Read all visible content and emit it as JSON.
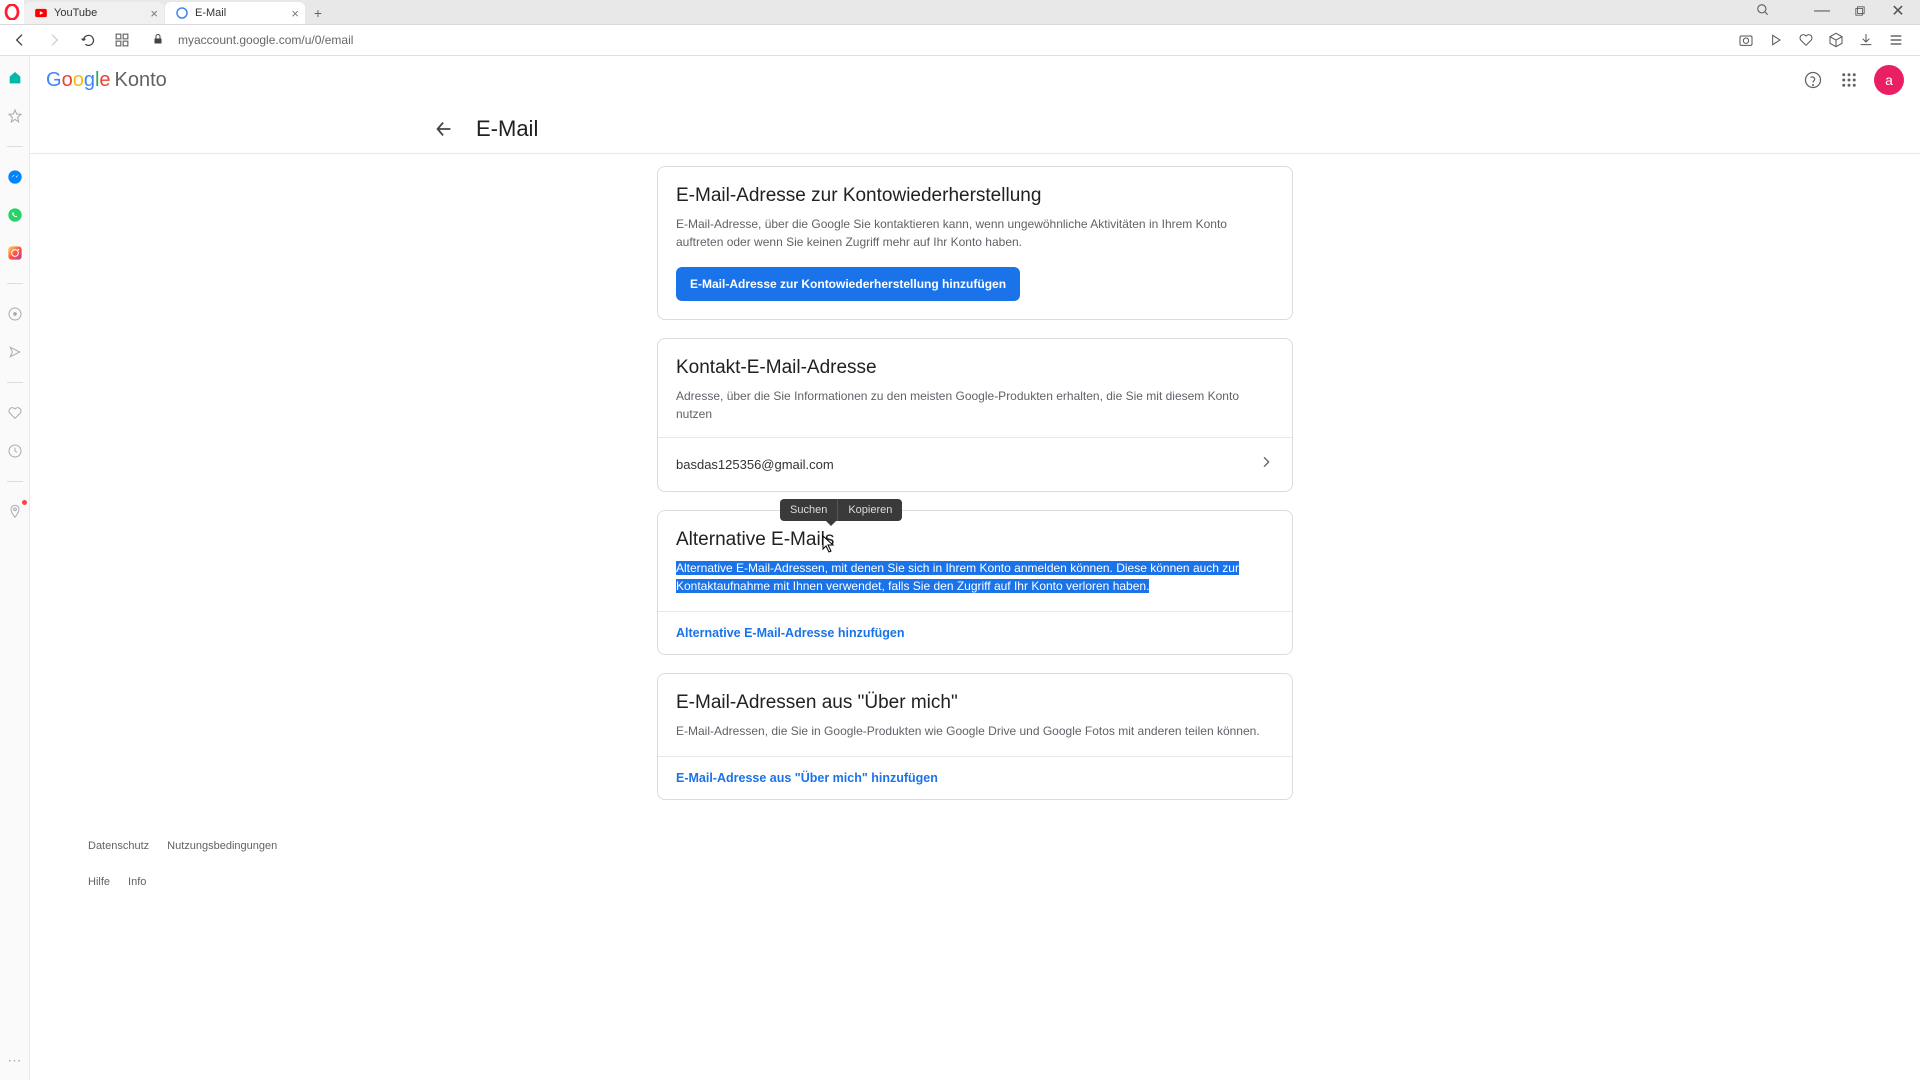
{
  "browser": {
    "tabs": [
      {
        "title": "YouTube",
        "active": false
      },
      {
        "title": "E-Mail",
        "active": true
      }
    ],
    "url": "myaccount.google.com/u/0/email"
  },
  "header": {
    "logo_suffix": "Konto",
    "avatar_letter": "a"
  },
  "page": {
    "title": "E-Mail"
  },
  "cards": {
    "recovery": {
      "title": "E-Mail-Adresse zur Kontowiederherstellung",
      "desc": "E-Mail-Adresse, über die Google Sie kontaktieren kann, wenn ungewöhnliche Aktivitäten in Ihrem Konto auftreten oder wenn Sie keinen Zugriff mehr auf Ihr Konto haben.",
      "button": "E-Mail-Adresse zur Kontowiederherstellung hinzufügen"
    },
    "contact": {
      "title": "Kontakt-E-Mail-Adresse",
      "desc": "Adresse, über die Sie Informationen zu den meisten Google-Produkten erhalten, die Sie mit diesem Konto nutzen",
      "email": "basdas125356@gmail.com"
    },
    "alternative": {
      "title": "Alternative E-Mails",
      "desc": "Alternative E-Mail-Adressen, mit denen Sie sich in Ihrem Konto anmelden können. Diese können auch zur Kontaktaufnahme mit Ihnen verwendet, falls Sie den Zugriff auf Ihr Konto verloren haben.",
      "link": "Alternative E-Mail-Adresse hinzufügen"
    },
    "about": {
      "title": "E-Mail-Adressen aus \"Über mich\"",
      "desc": "E-Mail-Adressen, die Sie in Google-Produkten wie Google Drive und Google Fotos mit anderen teilen können.",
      "link": "E-Mail-Adresse aus \"Über mich\" hinzufügen"
    }
  },
  "tooltip": {
    "search": "Suchen",
    "copy": "Kopieren"
  },
  "footer": {
    "privacy": "Datenschutz",
    "terms": "Nutzungsbedingungen",
    "help": "Hilfe",
    "info": "Info"
  }
}
